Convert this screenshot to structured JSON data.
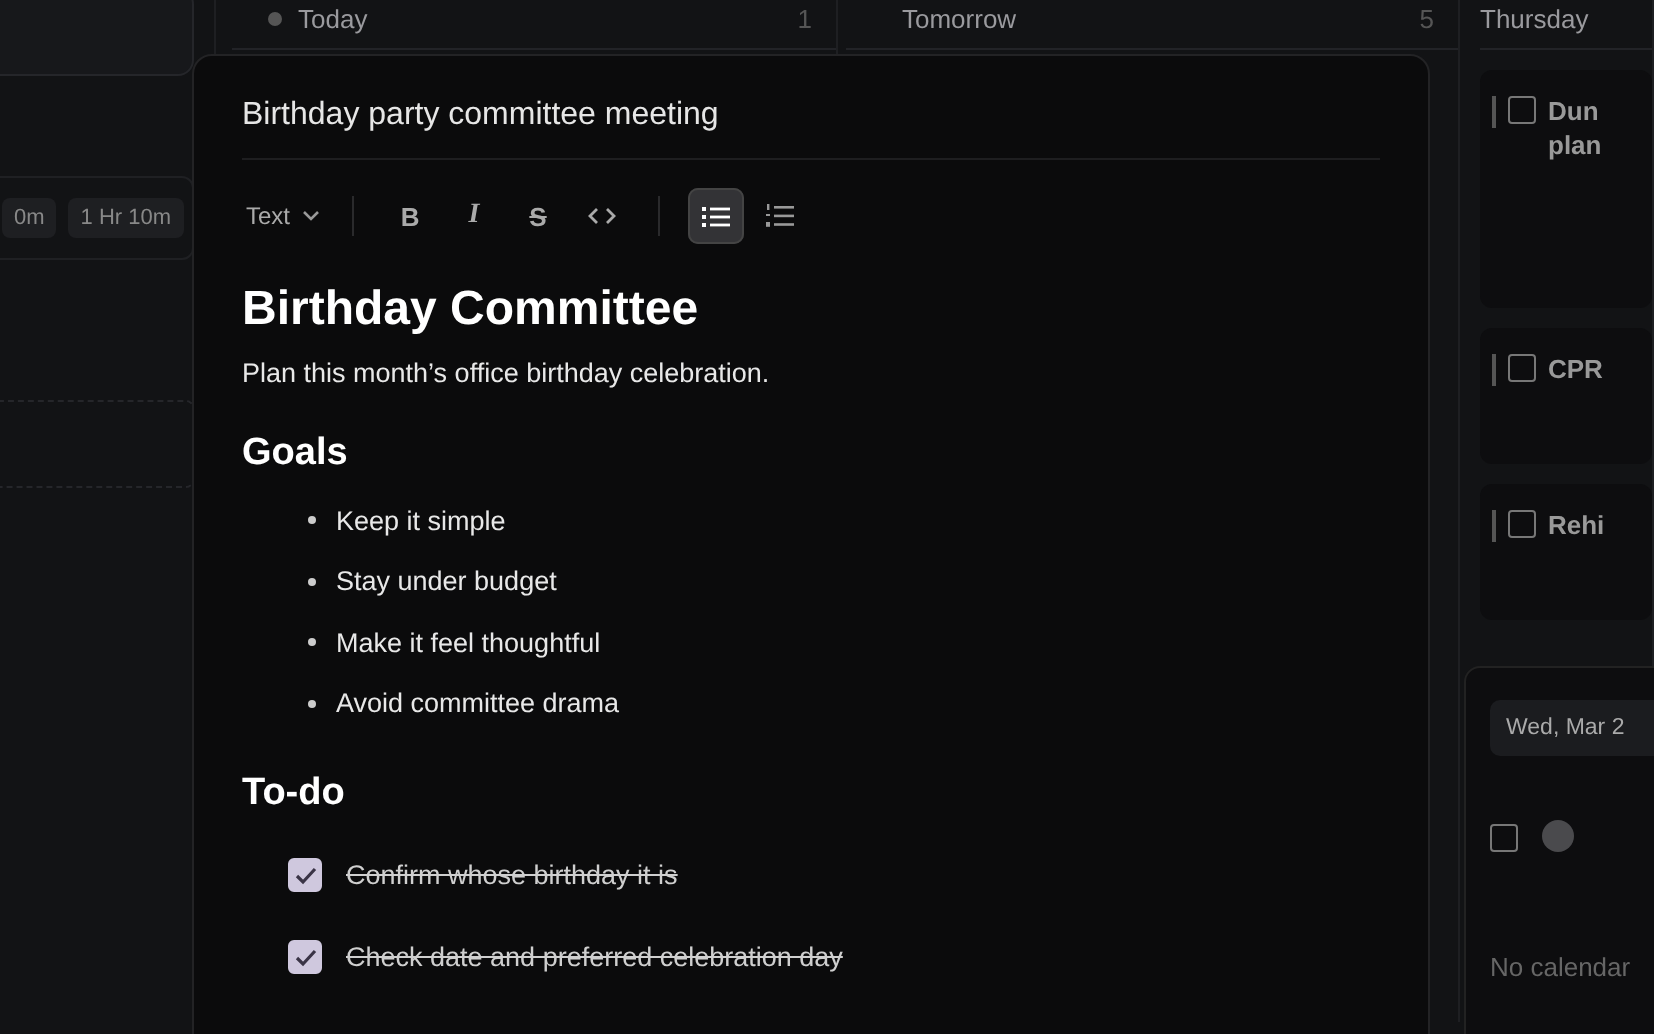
{
  "board": {
    "columns": [
      {
        "title": "Today",
        "count": "1"
      },
      {
        "title": "Tomorrow",
        "count": "5"
      },
      {
        "title": "Thursday"
      }
    ]
  },
  "left_panel": {
    "chips": [
      "0m",
      "1 Hr 10m"
    ]
  },
  "thursday_cards": [
    {
      "lines": [
        "Dun",
        "plan"
      ],
      "checked": false
    },
    {
      "lines": [
        "CPR"
      ],
      "checked": false
    },
    {
      "lines": [
        "Rehi"
      ],
      "checked": false
    }
  ],
  "side_panel": {
    "date": "Wed, Mar 2",
    "checked": false,
    "note": "No calendar"
  },
  "editor": {
    "title": "Birthday party committee meeting",
    "toolbar": [
      {
        "kind": "dropdown",
        "label": "Text"
      },
      {
        "kind": "bold",
        "glyph": "B",
        "selected": false
      },
      {
        "kind": "italic",
        "glyph": "I",
        "selected": false
      },
      {
        "kind": "strike",
        "glyph": "S",
        "selected": false
      },
      {
        "kind": "code",
        "selected": false
      },
      {
        "kind": "bullet_list",
        "selected": true
      },
      {
        "kind": "numbered_list",
        "selected": false
      }
    ],
    "blocks": [
      {
        "kind": "h1",
        "text": "Birthday Committee"
      },
      {
        "kind": "p",
        "text": "Plan this month’s office birthday celebration."
      },
      {
        "kind": "h2",
        "text": "Goals"
      },
      {
        "kind": "bullets",
        "items": [
          "Keep it simple",
          "Stay under budget",
          "Make it feel thoughtful",
          "Avoid committee drama"
        ]
      },
      {
        "kind": "h2",
        "text": "To-do"
      },
      {
        "kind": "todos",
        "items": [
          {
            "text": "Confirm whose birthday it is",
            "checked": true
          },
          {
            "text": "Check date and preferred celebration day",
            "checked": true
          }
        ]
      }
    ]
  }
}
